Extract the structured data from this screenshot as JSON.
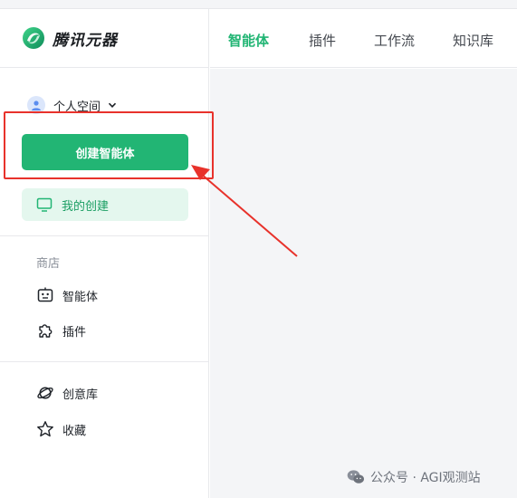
{
  "app": {
    "name": "腾讯元器"
  },
  "header": {
    "tabs": [
      {
        "label": "智能体",
        "active": true
      },
      {
        "label": "插件",
        "active": false
      },
      {
        "label": "工作流",
        "active": false
      },
      {
        "label": "知识库",
        "active": false
      }
    ]
  },
  "sidebar": {
    "workspace_label": "个人空间",
    "create_button_label": "创建智能体",
    "my_creations_label": "我的创建",
    "store_section_title": "商店",
    "store_items": [
      {
        "label": "智能体",
        "icon": "robot-icon"
      },
      {
        "label": "插件",
        "icon": "puzzle-icon"
      }
    ],
    "library_items": [
      {
        "label": "创意库",
        "icon": "planet-icon"
      },
      {
        "label": "收藏",
        "icon": "star-icon"
      }
    ]
  },
  "watermark": {
    "text": "公众号 · AGI观测站"
  },
  "colors": {
    "accent": "#22b574",
    "accent_light": "#e4f7ee",
    "annotation_red": "#e8322b",
    "main_background": "#f4f5f7"
  }
}
